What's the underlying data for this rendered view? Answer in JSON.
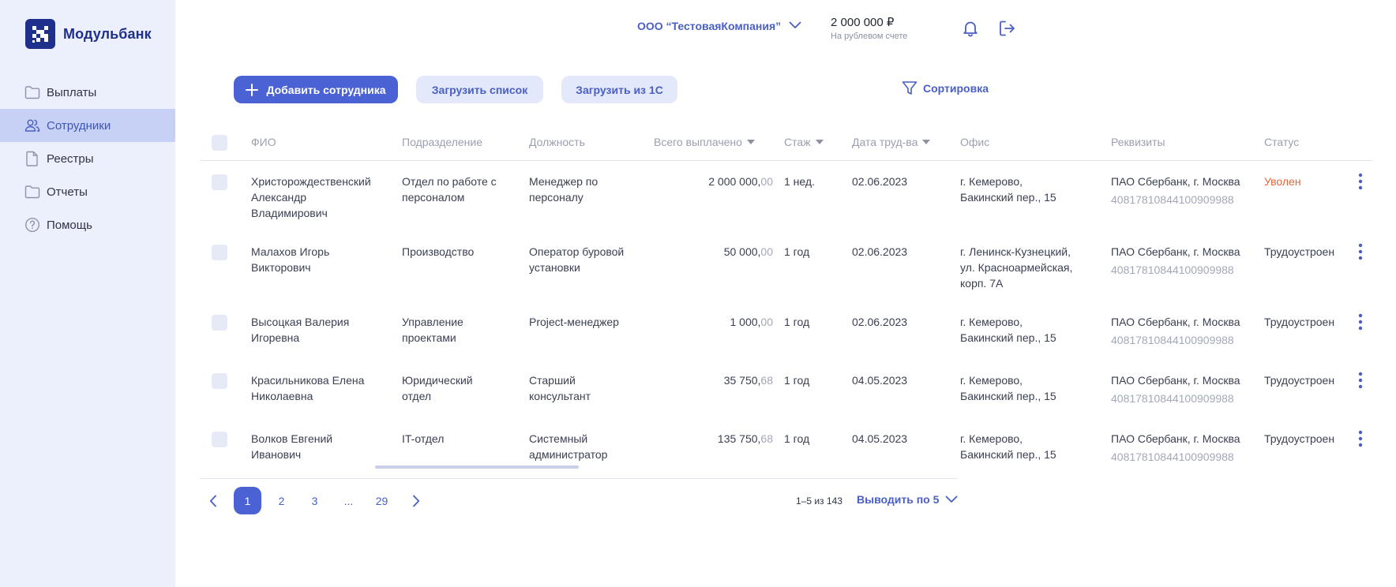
{
  "brand": {
    "name": "Модульбанк"
  },
  "sidebar": {
    "items": [
      {
        "label": "Выплаты",
        "icon": "folder-icon",
        "active": false
      },
      {
        "label": "Сотрудники",
        "icon": "users-icon",
        "active": true
      },
      {
        "label": "Реестры",
        "icon": "document-icon",
        "active": false
      },
      {
        "label": "Отчеты",
        "icon": "folder-icon",
        "active": false
      },
      {
        "label": "Помощь",
        "icon": "help-circle-icon",
        "active": false
      }
    ]
  },
  "header": {
    "company": "ООО “ТестоваяКомпания”",
    "balance": "2 000 000 ₽",
    "balance_note": "На рублевом счете",
    "icons": [
      "bell-icon",
      "logout-icon"
    ]
  },
  "toolbar": {
    "add_label": "Добавить сотрудника",
    "upload_list_label": "Загрузить список",
    "upload_1c_label": "Загрузить из 1С",
    "sort_label": "Сортировка"
  },
  "table": {
    "columns": [
      "ФИО",
      "Подразделение",
      "Должность",
      "Всего выплачено",
      "Стаж",
      "Дата труд-ва",
      "Офис",
      "Реквизиты",
      "Статус"
    ],
    "rows": [
      {
        "name": [
          "Христорождественский",
          "Александр",
          "Владимирович"
        ],
        "dept": [
          "Отдел по работе с",
          "персоналом"
        ],
        "position": [
          "Менеджер по",
          "персоналу"
        ],
        "amount_main": "2 000 000,",
        "amount_kop": "00",
        "tenure": "1 нед.",
        "date": "02.06.2023",
        "office": [
          "г. Кемерово,",
          "Бакинский пер., 15"
        ],
        "bank": "ПАО Сбербанк, г. Москва",
        "account": "40817810844100909988",
        "status": "Уволен"
      },
      {
        "name": [
          "Малахов Игорь",
          "Викторович"
        ],
        "dept": [
          "Производство"
        ],
        "position": [
          "Оператор буровой",
          "установки"
        ],
        "amount_main": "50 000,",
        "amount_kop": "00",
        "tenure": "1 год",
        "date": "02.06.2023",
        "office": [
          "г. Ленинск-Кузнецкий,",
          "ул. Красноармейская,",
          "корп. 7А"
        ],
        "bank": "ПАО Сбербанк, г. Москва",
        "account": "40817810844100909988",
        "status": "Трудоустроен"
      },
      {
        "name": [
          "Высоцкая Валерия",
          "Игоревна"
        ],
        "dept": [
          "Управление",
          "проектами"
        ],
        "position": [
          "Project-менеджер"
        ],
        "amount_main": "1 000,",
        "amount_kop": "00",
        "tenure": "1 год",
        "date": "02.06.2023",
        "office": [
          "г. Кемерово,",
          "Бакинский пер., 15"
        ],
        "bank": "ПАО Сбербанк, г. Москва",
        "account": "40817810844100909988",
        "status": "Трудоустроен"
      },
      {
        "name": [
          "Красильникова Елена",
          "Николаевна"
        ],
        "dept": [
          "Юридический",
          "отдел"
        ],
        "position": [
          "Старший",
          "консультант"
        ],
        "amount_main": "35 750,",
        "amount_kop": "68",
        "tenure": "1 год",
        "date": "04.05.2023",
        "office": [
          "г. Кемерово,",
          "Бакинский пер., 15"
        ],
        "bank": "ПАО Сбербанк, г. Москва",
        "account": "40817810844100909988",
        "status": "Трудоустроен"
      },
      {
        "name": [
          "Волков Евгений",
          "Иванович"
        ],
        "dept": [
          "IT-отдел"
        ],
        "position": [
          "Системный",
          "администратор"
        ],
        "amount_main": "135 750,",
        "amount_kop": "68",
        "tenure": "1 год",
        "date": "04.05.2023",
        "office": [
          "г. Кемерово,",
          "Бакинский пер., 15"
        ],
        "bank": "ПАО Сбербанк, г. Москва",
        "account": "40817810844100909988",
        "status": "Трудоустроен"
      }
    ]
  },
  "pagination": {
    "pages": [
      "1",
      "2",
      "3",
      "...",
      "29"
    ],
    "current": "1",
    "range": "1–5 из 143",
    "per_page": "Выводить по 5"
  },
  "colors": {
    "accent": "#4a62d4",
    "sidebar_bg": "#eceffc",
    "active_nav": "#c7d0f5",
    "status_fired": "#e0663a"
  }
}
